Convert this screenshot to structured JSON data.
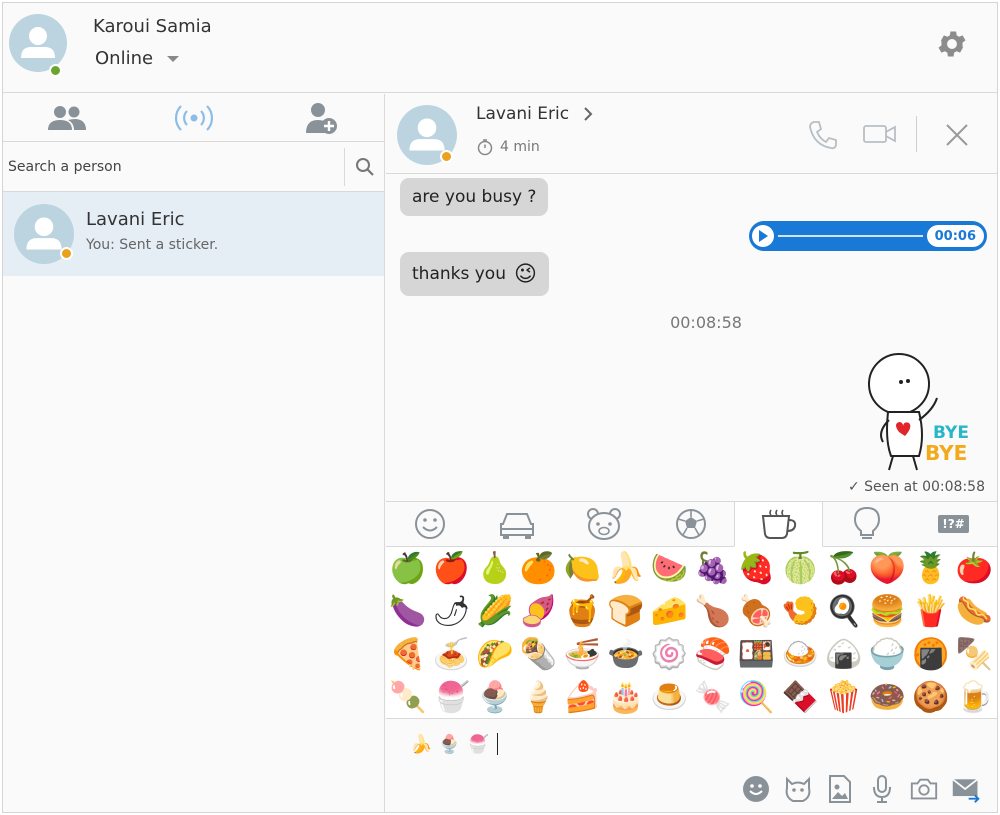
{
  "user": {
    "name": "Karoui Samia",
    "status": "Online",
    "presence_color": "#6aa62e"
  },
  "search": {
    "placeholder": "Search a person"
  },
  "contacts": [
    {
      "name": "Lavani Eric",
      "preview": "You: Sent a sticker.",
      "presence_color": "#e9a11e"
    }
  ],
  "chat": {
    "peer_name": "Lavani Eric",
    "last_seen": "4 min",
    "messages": [
      {
        "type": "text",
        "text": "are you busy ?"
      },
      {
        "type": "audio",
        "duration": "00:06"
      },
      {
        "type": "text",
        "text": "thanks you",
        "emoji": "😉"
      },
      {
        "type": "timestamp",
        "text": "00:08:58"
      },
      {
        "type": "sticker",
        "caption": "BYE BYE"
      }
    ],
    "seen": "Seen at 00:08:58"
  },
  "emoji_tabs": [
    "smiley-icon",
    "car-icon",
    "bear-icon",
    "soccer-ball-icon",
    "cup-icon",
    "bulb-icon",
    "symbols-icon"
  ],
  "emoji_tab_symbols_label": "!?#",
  "emojis": [
    "🍏",
    "🍎",
    "🍐",
    "🍊",
    "🍋",
    "🍌",
    "🍉",
    "🍇",
    "🍓",
    "🍈",
    "🍒",
    "🍑",
    "🍍",
    "🍅",
    "🍆",
    "🌶",
    "🌽",
    "🍠",
    "🍯",
    "🍞",
    "🧀",
    "🍗",
    "🍖",
    "🍤",
    "🍳",
    "🍔",
    "🍟",
    "🌭",
    "🍕",
    "🍝",
    "🌮",
    "🌯",
    "🍜",
    "🍲",
    "🍥",
    "🍣",
    "🍱",
    "🍛",
    "🍙",
    "🍚",
    "🍘",
    "🍢",
    "🍡",
    "🍧",
    "🍨",
    "🍦",
    "🍰",
    "🎂",
    "🍮",
    "🍬",
    "🍭",
    "🍫",
    "🍿",
    "🍩",
    "🍪",
    "🍺"
  ],
  "composer": {
    "text": "🍌🍨🍧"
  },
  "colors": {
    "accent": "#1979d6",
    "selected_row": "#e5eef5",
    "bubble": "#d6d6d6"
  }
}
